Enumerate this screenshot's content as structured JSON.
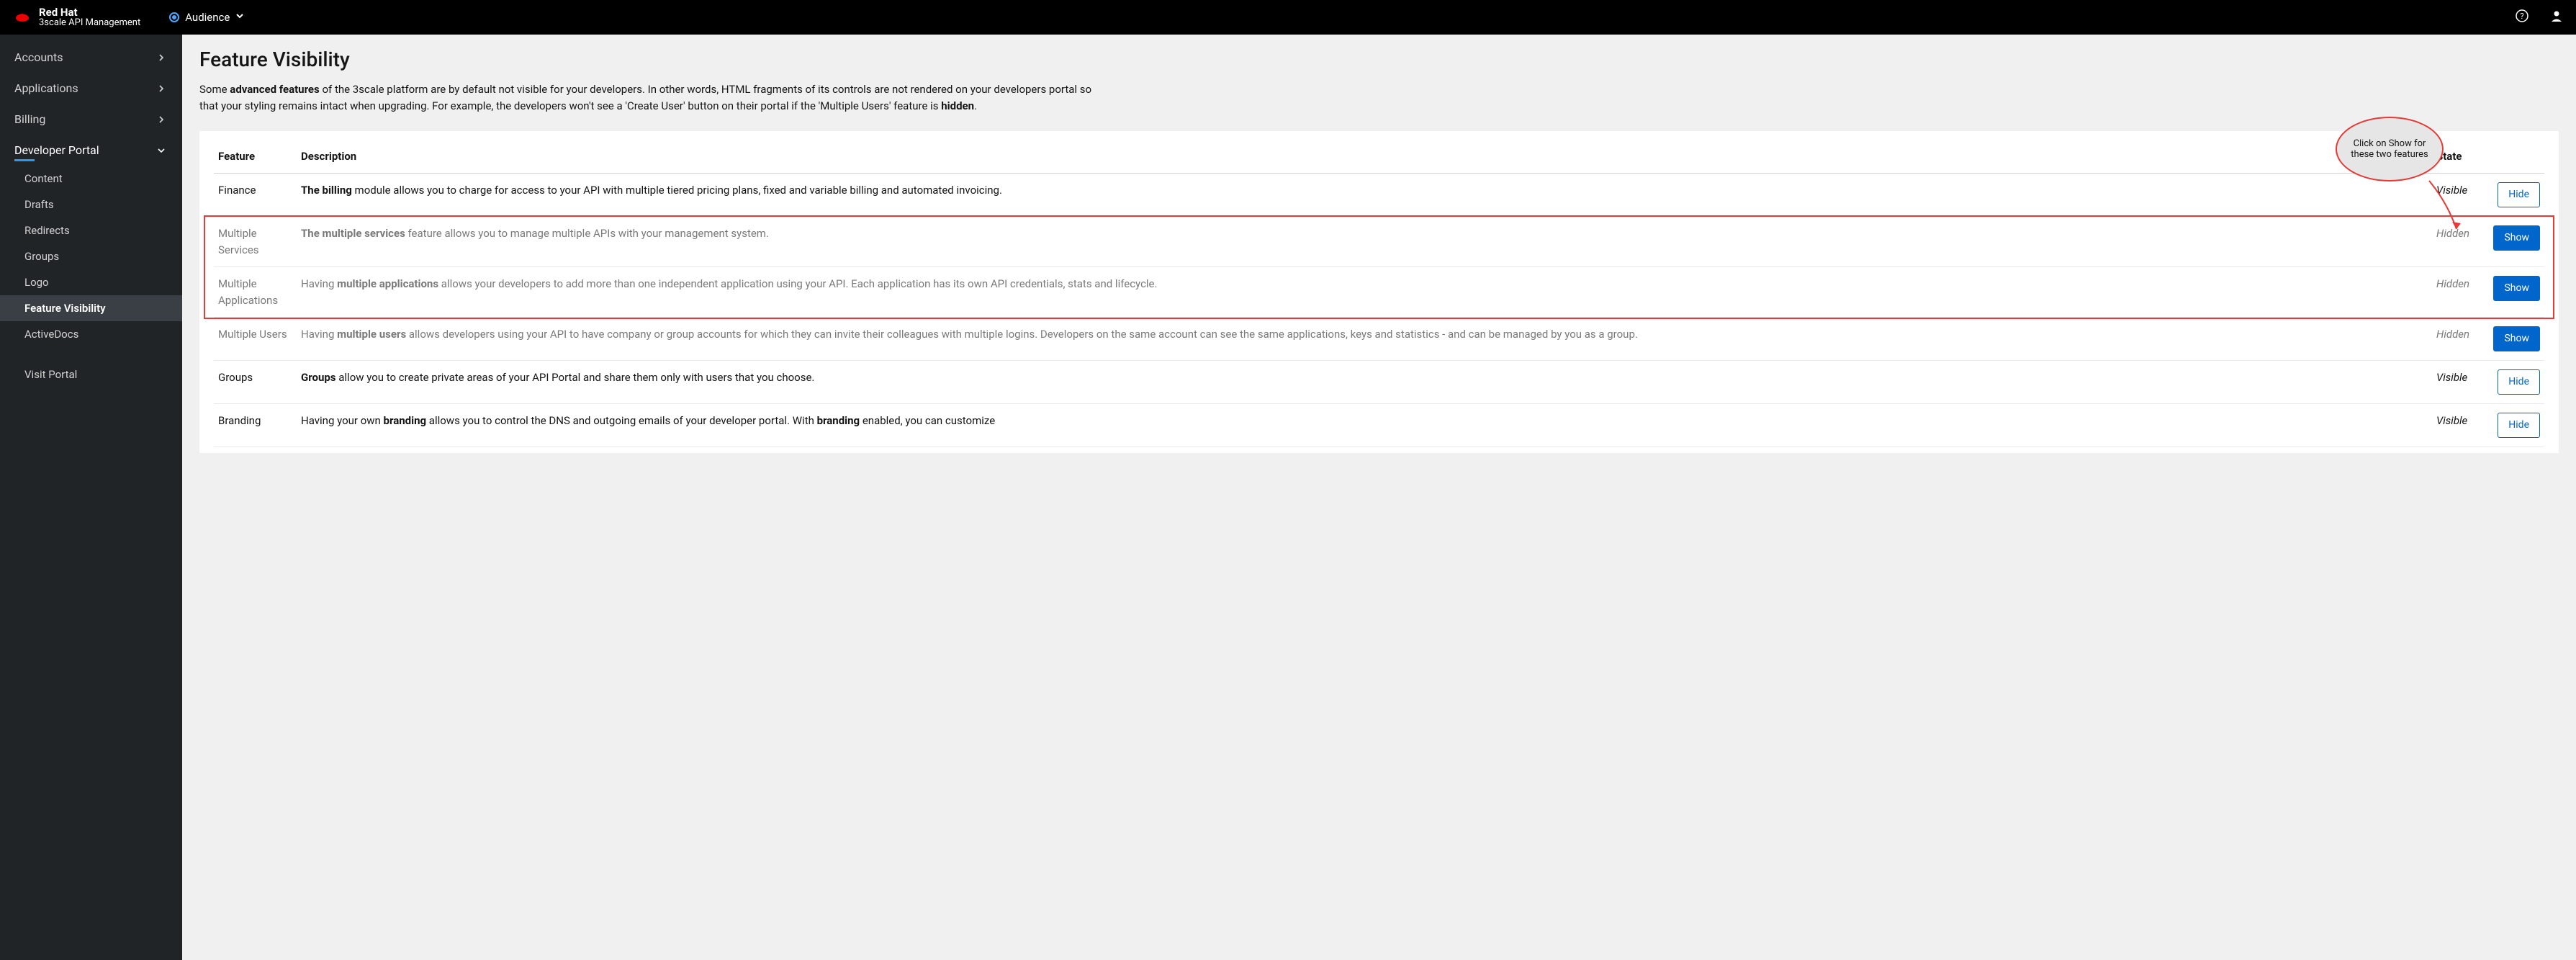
{
  "brand": {
    "name": "Red Hat",
    "product": "3scale API Management"
  },
  "topbar": {
    "audience_label": "Audience"
  },
  "sidebar": {
    "items": [
      {
        "label": "Accounts",
        "expandable": true
      },
      {
        "label": "Applications",
        "expandable": true
      },
      {
        "label": "Billing",
        "expandable": true
      },
      {
        "label": "Developer Portal",
        "expandable": true,
        "expanded": true
      }
    ],
    "sub_items": [
      {
        "label": "Content"
      },
      {
        "label": "Drafts"
      },
      {
        "label": "Redirects"
      },
      {
        "label": "Groups"
      },
      {
        "label": "Logo"
      },
      {
        "label": "Feature Visibility",
        "active": true
      },
      {
        "label": "ActiveDocs"
      }
    ],
    "visit_portal": "Visit Portal"
  },
  "page": {
    "title": "Feature Visibility",
    "intro_prefix": "Some ",
    "intro_bold1": "advanced features",
    "intro_mid": " of the 3scale platform are by default not visible for your developers. In other words, HTML fragments of its controls are not rendered on your developers portal so that your styling remains intact when upgrading. For example, the developers won't see a 'Create User' button on their portal if the 'Multiple Users' feature is ",
    "intro_bold2": "hidden",
    "intro_end": "."
  },
  "annotation": {
    "text": "Click on Show for these two features"
  },
  "table": {
    "headers": {
      "feature": "Feature",
      "description": "Description",
      "state": "State"
    },
    "actions": {
      "show": "Show",
      "hide": "Hide"
    },
    "rows": [
      {
        "feature": "Finance",
        "state": "Visible",
        "visible": true,
        "desc_parts": [
          {
            "bold": true,
            "text": "The billing"
          },
          {
            "bold": false,
            "text": " module allows you to charge for access to your API with multiple tiered pricing plans, fixed and variable billing and automated invoicing."
          }
        ]
      },
      {
        "feature": "Multiple Services",
        "state": "Hidden",
        "visible": false,
        "highlighted": true,
        "desc_parts": [
          {
            "bold": true,
            "text": "The multiple services"
          },
          {
            "bold": false,
            "text": " feature allows you to manage multiple APIs with your management system."
          }
        ]
      },
      {
        "feature": "Multiple Applications",
        "state": "Hidden",
        "visible": false,
        "highlighted": true,
        "desc_parts": [
          {
            "bold": false,
            "text": "Having "
          },
          {
            "bold": true,
            "text": "multiple applications"
          },
          {
            "bold": false,
            "text": " allows your developers to add more than one independent application using your API. Each application has its own API credentials, stats and lifecycle."
          }
        ]
      },
      {
        "feature": "Multiple Users",
        "state": "Hidden",
        "visible": false,
        "desc_parts": [
          {
            "bold": false,
            "text": "Having "
          },
          {
            "bold": true,
            "text": "multiple users"
          },
          {
            "bold": false,
            "text": " allows developers using your API to have company or group accounts for which they can invite their colleagues with multiple logins. Developers on the same account can see the same applications, keys and statistics - and can be managed by you as a group."
          }
        ]
      },
      {
        "feature": "Groups",
        "state": "Visible",
        "visible": true,
        "desc_parts": [
          {
            "bold": true,
            "text": "Groups"
          },
          {
            "bold": false,
            "text": " allow you to create private areas of your API Portal and share them only with users that you choose."
          }
        ]
      },
      {
        "feature": "Branding",
        "state": "Visible",
        "visible": true,
        "desc_parts": [
          {
            "bold": false,
            "text": "Having your own "
          },
          {
            "bold": true,
            "text": "branding"
          },
          {
            "bold": false,
            "text": " allows you to control the DNS and outgoing emails of your developer portal. With "
          },
          {
            "bold": true,
            "text": "branding"
          },
          {
            "bold": false,
            "text": " enabled, you can customize"
          }
        ]
      }
    ]
  }
}
